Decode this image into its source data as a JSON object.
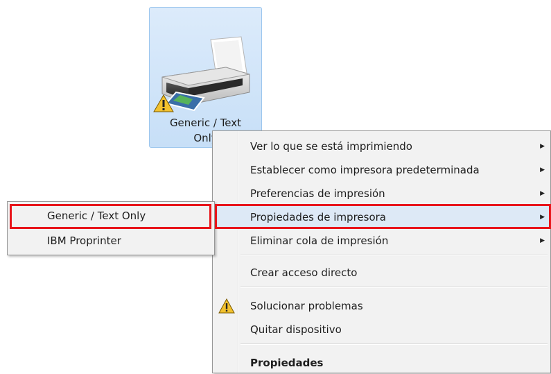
{
  "printer_tile": {
    "name_line1": "Generic / Text",
    "name_line2": "Only",
    "icon": "printer-icon",
    "status_icon": "warning-icon"
  },
  "context_menu": {
    "items": [
      {
        "label": "Ver lo que se está imprimiendo",
        "has_submenu": true
      },
      {
        "label": "Establecer como impresora predeterminada",
        "has_submenu": true
      },
      {
        "label": "Preferencias de impresión",
        "has_submenu": true
      },
      {
        "label": "Propiedades de impresora",
        "has_submenu": true,
        "highlighted": true
      },
      {
        "label": "Eliminar cola de impresión",
        "has_submenu": true
      },
      {
        "label": "Crear acceso directo",
        "has_submenu": false
      },
      {
        "label": "Solucionar problemas",
        "has_submenu": false,
        "icon": "warning-icon"
      },
      {
        "label": "Quitar dispositivo",
        "has_submenu": false
      },
      {
        "label": "Propiedades",
        "has_submenu": false,
        "bold": true
      }
    ],
    "arrow_glyph": "▶"
  },
  "submenu": {
    "items": [
      {
        "label": "Generic / Text Only",
        "highlighted": true
      },
      {
        "label": "IBM Proprinter"
      }
    ]
  },
  "colors": {
    "highlight_frame": "#e8151b",
    "selection_fill": "#cde3f7",
    "menu_background": "#f2f2f2"
  }
}
